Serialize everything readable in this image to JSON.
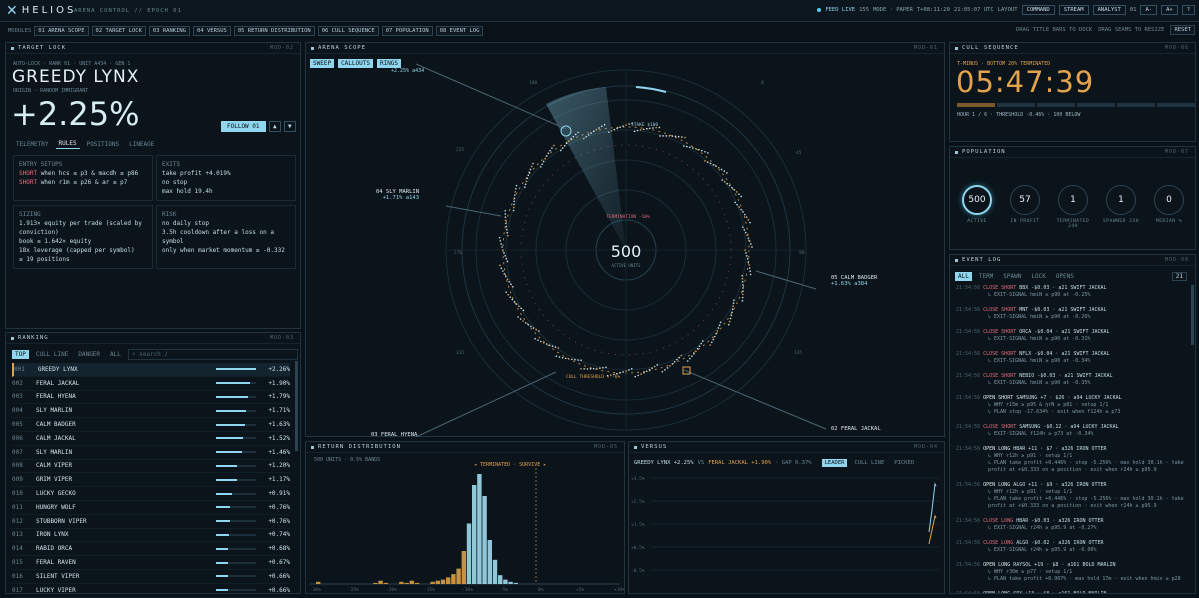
{
  "brand": {
    "name": "HELIOS",
    "subtitle": "ARENA CONTROL // EPOCH 01"
  },
  "status": {
    "feed": "FEED LIVE",
    "count": "155",
    "mode": "MODE · PAPER",
    "t": "T+08:11:20",
    "clock": "21:05:07 UTC",
    "layout": "LAYOUT",
    "buttons": [
      "COMMAND",
      "STREAM",
      "ANALYST"
    ],
    "zoom": "01",
    "zoom_btns": [
      "A-",
      "A+",
      "?"
    ]
  },
  "modules": {
    "label": "MODULES",
    "items": [
      "01 ARENA SCOPE",
      "02 TARGET LOCK",
      "03 RANKING",
      "04 VERSUS",
      "05 RETURN DISTRIBUTION",
      "06 CULL SEQUENCE",
      "07 POPULATION",
      "08 EVENT LOG"
    ],
    "hint1": "DRAG TITLE BARS TO DOCK",
    "hint2": "DRAG SEAMS TO RESIZE",
    "reset": "RESET"
  },
  "target": {
    "title": "TARGET LOCK",
    "mod": "MOD-02",
    "meta": "AUTO-LOCK · RANK 01 · UNIT A434 · GEN 1",
    "name": "GREEDY LYNX",
    "origin": "ORIGIN · RANDOM IMMIGRANT",
    "ret": "+2.25%",
    "follow": "FOLLOW 01",
    "tabs": [
      "TELEMETRY",
      "RULES",
      "POSITIONS",
      "LINEAGE"
    ],
    "entry_h": "ENTRY SETUPS",
    "entry": [
      [
        "SHORT",
        "when hcs ≤ p3 & macdh ≥ p86"
      ],
      [
        "SHORT",
        "when r1m ≤ p26 & ar ≤ p7"
      ]
    ],
    "exits_h": "EXITS",
    "exits": [
      "take profit +4.019%",
      "no stop",
      "max hold 19.4h"
    ],
    "sizing_h": "SIZING",
    "sizing": [
      "1.913× equity per trade (scaled by",
      "conviction)",
      "book ≤ 1.642× equity",
      "18x leverage (capped per symbol)",
      "≤ 19 positions"
    ],
    "risk_h": "RISK",
    "risk": [
      "no daily stop",
      "3.5h cooldown after a loss on a symbol",
      "only when market momentum ≥ -0.332"
    ]
  },
  "ranking": {
    "title": "RANKING",
    "mod": "MOD-03",
    "tabs": [
      "TOP",
      "CULL LINE",
      "DANGER",
      "ALL"
    ],
    "search": "⌕ search  /",
    "rows": [
      [
        "001",
        "GREEDY LYNX",
        "+2.26%",
        1
      ],
      [
        "002",
        "FERAL JACKAL",
        "+1.90%",
        0.84
      ],
      [
        "003",
        "FERAL HYENA",
        "+1.79%",
        0.79
      ],
      [
        "004",
        "SLY MARLIN",
        "+1.71%",
        0.76
      ],
      [
        "005",
        "CALM BADGER",
        "+1.63%",
        0.72
      ],
      [
        "006",
        "CALM JACKAL",
        "+1.52%",
        0.67
      ],
      [
        "007",
        "SLY MARLIN",
        "+1.46%",
        0.65
      ],
      [
        "008",
        "CALM VIPER",
        "+1.20%",
        0.53
      ],
      [
        "009",
        "GRIM VIPER",
        "+1.17%",
        0.52
      ],
      [
        "010",
        "LUCKY GECKO",
        "+0.91%",
        0.4
      ],
      [
        "011",
        "HUNGRY WOLF",
        "+0.76%",
        0.34
      ],
      [
        "012",
        "STUBBORN VIPER",
        "+0.76%",
        0.34
      ],
      [
        "013",
        "IRON LYNX",
        "+0.74%",
        0.33
      ],
      [
        "014",
        "RABID ORCA",
        "+0.68%",
        0.3
      ],
      [
        "015",
        "FERAL RAVEN",
        "+0.67%",
        0.3
      ],
      [
        "016",
        "SILENT VIPER",
        "+0.66%",
        0.29
      ],
      [
        "017",
        "LUCKY VIPER",
        "+0.66%",
        0.29
      ]
    ]
  },
  "scope": {
    "title": "ARENA SCOPE",
    "mod": "MOD-01",
    "btns": [
      "SWEEP",
      "CALLOUTS",
      "RINGS"
    ],
    "center": "500",
    "center_sub": "ACTIVE UNITS",
    "termination": "TERMINATION -10%",
    "stake": "STAKE $100",
    "cull": "CULL THRESHOLD ≈ -6%",
    "callouts": [
      {
        "n": "04 SLY MARLIN",
        "v": "+1.71%  a143"
      },
      {
        "n": "05 CALM BADGER",
        "v": "+1.63%  a384"
      },
      {
        "n": "02 FERAL JACKAL",
        "v": "+1.90%  a6"
      },
      {
        "n": "03 FERAL HYENA",
        "v": ""
      },
      {
        "n": "",
        "v": "+2.25%  a434"
      }
    ],
    "ticks": [
      "180",
      "225",
      "270",
      "315",
      "0",
      "45",
      "90",
      "135"
    ]
  },
  "dist": {
    "title": "RETURN DISTRIBUTION",
    "mod": "MOD-05",
    "meta": "500 UNITS · 0.5% BANDS",
    "label": "◂ TERMINATED · SURVIVE ▸",
    "xticks": [
      "-30%",
      "-25%",
      "-20%",
      "-15%",
      "-10%",
      "-5%",
      "0%",
      "+5%",
      "+10%"
    ]
  },
  "versus": {
    "title": "VERSUS",
    "mod": "MOD-04",
    "a": "GREEDY LYNX +2.25%",
    "vs": "VS",
    "b": "FERAL JACKAL +1.90%",
    "gap": "· GAP 0.37%",
    "tabs": [
      "LEADER",
      "CULL LINE",
      "PICKED"
    ],
    "yticks": [
      "+3.5%",
      "+2.5%",
      "+1.5%",
      "+0.5%",
      "-0.5%",
      "-1.5%"
    ]
  },
  "cull": {
    "title": "CULL SEQUENCE",
    "mod": "MOD-06",
    "meta": "T-MINUS · BOTTOM 20% TERMINATED",
    "time": "05:47:39",
    "hour": "HOUR 1 / 6  ·  THRESHOLD -0.46%  ·  100 BELOW"
  },
  "pop": {
    "title": "POPULATION",
    "mod": "MOD-07",
    "items": [
      [
        "500",
        "ACTIVE"
      ],
      [
        "57",
        "IN PROFIT"
      ],
      [
        "1",
        "TERMINATED 24H"
      ],
      [
        "1",
        "SPAWNED 24H"
      ],
      [
        "0",
        "MEDIAN %"
      ]
    ]
  },
  "log": {
    "title": "EVENT LOG",
    "mod": "MOD-08",
    "tabs": [
      "ALL",
      "TERM",
      "SPAWN",
      "LOCK",
      "OPENS"
    ],
    "count": "21",
    "events": [
      {
        "ts": "21:54:56",
        "a": "CLOSE SHORT",
        "s": "BBX -$0.03 · a21 SWIFT JACKAL",
        "l": [
          "↳ EXIT-SIGNAL hmiN ≥ p90 at -0.25%"
        ]
      },
      {
        "ts": "21:54:56",
        "a": "CLOSE SHORT",
        "s": "MNT -$0.03 · a21 SWIFT JACKAL",
        "l": [
          "↳ EXIT-SIGNAL hmiN ≥ p90 at -0.26%"
        ]
      },
      {
        "ts": "21:54:56",
        "a": "CLOSE SHORT",
        "s": "ORCA -$0.04 · a21 SWIFT JACKAL",
        "l": [
          "↳ EXIT-SIGNAL hmiN ≥ p90 at -0.31%"
        ]
      },
      {
        "ts": "21:54:56",
        "a": "CLOSE SHORT",
        "s": "NFLX -$0.04 · a21 SWIFT JACKAL",
        "l": [
          "↳ EXIT-SIGNAL hmiN ≥ p90 at -0.34%"
        ]
      },
      {
        "ts": "21:54:56",
        "a": "CLOSE SHORT",
        "s": "NEBIO -$0.03 · a21 SWIFT JACKAL",
        "l": [
          "↳ EXIT-SIGNAL hmiN ≥ p90 at -0.35%"
        ]
      },
      {
        "ts": "21:54:56",
        "a": "OPEN SHORT",
        "s": "SAMSUNG +7 · $26 · a94 LUCKY JACKAL",
        "l": [
          "↳ WHY r15m ≥ p95 & ηrN ≥ p81 · setup 1/1",
          "↳ PLAN stop -17.634% · exit when f124h ≥ p73"
        ]
      },
      {
        "ts": "21:54:56",
        "a": "CLOSE SHORT",
        "s": "SAMSUNG -$0.12 · a94 LUCKY JACKAL",
        "l": [
          "↳ EXIT-SIGNAL f124h ≥ p73 at -0.34%"
        ]
      },
      {
        "ts": "21:54:56",
        "a": "OPEN LONG",
        "s": "HBAR +11 · $7 · a326 IRON OTTER",
        "l": [
          "↳ WHY r12h ≥ p91 · setup 1/1",
          "↳ PLAN take profit +0.446% · stop -5.256% · max hold 30.1h · take",
          "profit at +$0.333 on a position · exit when r24h ≥ p95.9"
        ]
      },
      {
        "ts": "21:54:56",
        "a": "OPEN LONG",
        "s": "ALGO +11 · $9 · a326 IRON OTTER",
        "l": [
          "↳ WHY r12h ≥ p91 · setup 1/1",
          "↳ PLAN take profit +0.446% · stop -5.256% · max hold 30.1h · take",
          "profit at +$0.333 on a position · exit when r24h ≥ p95.9"
        ]
      },
      {
        "ts": "21:54:56",
        "a": "CLOSE LONG",
        "s": "HBAR -$0.03 · a326 IRON OTTER",
        "l": [
          "↳ EXIT-SIGNAL r24h ≥ p95.9 at -0.27%"
        ]
      },
      {
        "ts": "21:54:56",
        "a": "CLOSE LONG",
        "s": "ALGO -$0.02 · a326 IRON OTTER",
        "l": [
          "↳ EXIT-SIGNAL r24h ≥ p95.9 at -0.06%"
        ]
      },
      {
        "ts": "21:54:56",
        "a": "OPEN LONG",
        "s": "RAYSOL +19 · $8 · a161 BOLD MARLIN",
        "l": [
          "↳ WHY r30m ≥ p77 · setup 1/1",
          "↳ PLAN take profit +0.907% · max hold 17m · exit when hmiv ≥ p28"
        ]
      },
      {
        "ts": "21:54:56",
        "a": "OPEN LONG",
        "s": "SPX +13 · $8 · a161 BOLD MARLIN",
        "l": []
      }
    ]
  }
}
